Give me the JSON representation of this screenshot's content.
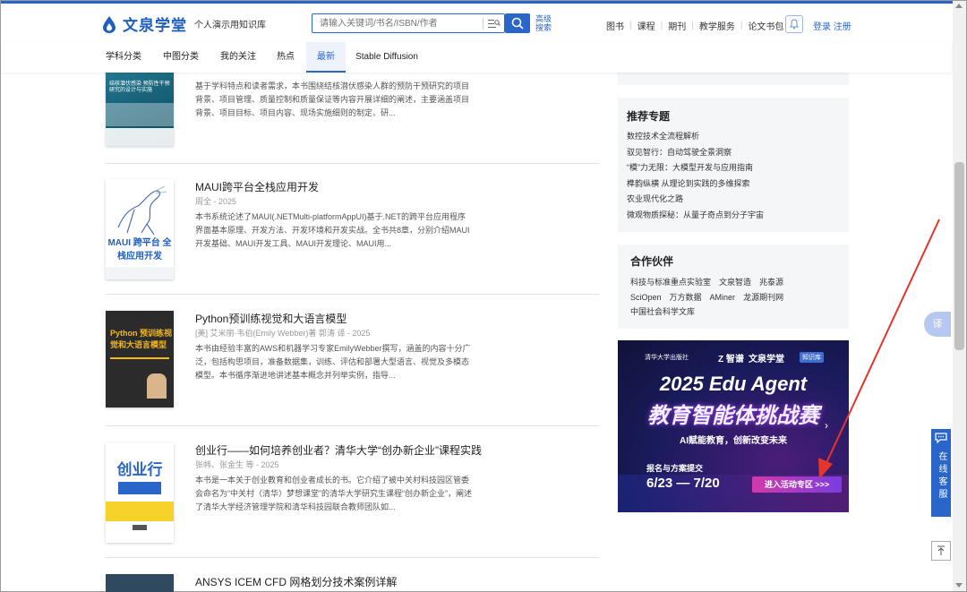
{
  "header": {
    "logo_text": "文泉学堂",
    "logo_sub": "个人演示用知识库",
    "search_placeholder": "请输入关键词/书名/ISBN/作者",
    "advanced_search": "高级搜索",
    "nav": [
      "图书",
      "课程",
      "期刊",
      "教学服务",
      "论文书包"
    ],
    "login": "登录 注册"
  },
  "subnav": {
    "tabs": [
      "学科分类",
      "中图分类",
      "我的关注",
      "热点",
      "最新",
      "Stable Diffusion"
    ],
    "active": "最新"
  },
  "books": [
    {
      "cover_title": "结核潜伏感染 预防性干预研究的设计与实施",
      "title": "",
      "author": "",
      "desc": "基于学科特点和读者需求，本书围绕结核潜伏感染人群的预防干预研究的项目背景、项目管理、质量控制和质量保证等内容开展详细的阐述，主要涵盖项目背景、项目目标、项目内容、现场实施细则的制定、研..."
    },
    {
      "cover_title": "MAUI 跨平台 全栈应用开发",
      "title": "MAUI跨平台全栈应用开发",
      "author": "周全 - 2025",
      "desc": "本书系统论述了MAUI(.NETMulti-platformAppUI)基于.NET的跨平台应用程序界面基本原理、开发方法、开发环境和开发实战。全书共8章，分别介绍MAUI开发基础、MAUI开发工具、MAUI开发理论、MAUI用..."
    },
    {
      "cover_title": "Python 预训练视觉和大语言模型",
      "title": "Python预训练视觉和大语言模型",
      "author": "[美] 艾米丽·韦伯(Emily Webber)著 郭涛 译 - 2025",
      "desc": "本书由经验丰富的AWS和机器学习专家EmilyWebber撰写，涵盖的内容十分广泛，包括构思项目，准备数据集，训练、评估和部署大型语言、视觉及多模态模型。本书循序渐进地讲述基本概念并列举实例，指导..."
    },
    {
      "cover_title": "创业行",
      "title": "创业行——如何培养创业者？清华大学“创办新企业”课程实践",
      "author": "张帏、张金生 等 - 2025",
      "desc": "本书是一本关于创业教育和创业者成长的书。它介绍了被中关村科技园区管委会命名为“中关村（清华）梦想课堂”的清华大学研究生课程“创办新企业”，阐述了清华大学经济管理学院和清华科技园联合教师团队如..."
    },
    {
      "cover_title": "",
      "title": "ANSYS ICEM CFD 网格划分技术案例详解",
      "author": "",
      "desc": ""
    }
  ],
  "sidebar": {
    "topics_title": "推荐专题",
    "topics": [
      "数控技术全流程解析",
      "驭见智行：自动驾驶全景洞察",
      "“模”力无限：大模型开发与应用指南",
      "榫韵纵横 从理论到实践的多维探索",
      "农业现代化之路",
      "微观物质探秘：从量子奇点到分子宇宙"
    ],
    "partners_title": "合作伙伴",
    "partners": [
      [
        "科技与标准重点实验室",
        "文泉智造",
        "兆泰源"
      ],
      [
        "SciOpen",
        "万方数据",
        "AMiner",
        "龙源期刊网"
      ],
      [
        "中国社会科学文库"
      ]
    ]
  },
  "ad": {
    "brand_thu": "清华大学出版社",
    "brand_zp": "智谱",
    "brand_wq": "文泉学堂",
    "brand_tag": "知识库",
    "headline": "2025 Edu Agent",
    "subheadline": "教育智能体挑战赛",
    "slogan": "AI赋能教育，创新改变未来",
    "signup": "报名与方案提交",
    "dates": "6/23 — 7/20",
    "cta": "进入活动专区 >>>"
  },
  "float": {
    "translate": "译",
    "customer_service": "在线客服"
  },
  "colors": {
    "brand_blue": "#2a66c9",
    "annotation_red": "#e5352b",
    "ad_bg": "#15174a"
  }
}
